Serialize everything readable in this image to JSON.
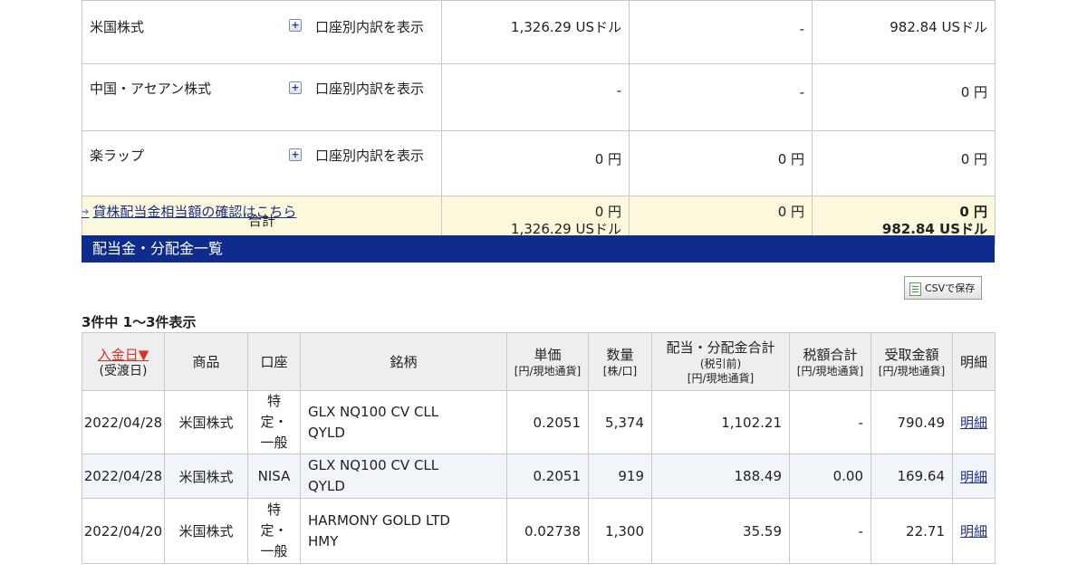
{
  "summary": {
    "rows": [
      {
        "name": "米国株式",
        "detail_link": "口座別内訳を表示",
        "col1": "1,326.29 USドル",
        "col2": "-",
        "col3": "982.84 USドル"
      },
      {
        "name": "中国・アセアン株式",
        "detail_link": "口座別内訳を表示",
        "col1": "-",
        "col2": "-",
        "col3": "0 円"
      },
      {
        "name": "楽ラップ",
        "detail_link": "口座別内訳を表示",
        "col1": "0 円",
        "col2": "0 円",
        "col3": "0 円"
      }
    ],
    "total": {
      "label": "合計",
      "col1_line1": "0 円",
      "col1_line2": "1,326.29 USドル",
      "col2": "0 円",
      "col3_line1": "0 円",
      "col3_line2": "982.84 USドル"
    }
  },
  "lending_link": "貸株配当金相当額の確認はこちら",
  "section_title": "配当金・分配金一覧",
  "csv_button": "CSVで保存",
  "result_count": "3件中 1〜3件表示",
  "table": {
    "headers": {
      "date_main": "入金日▼",
      "date_sub": "(受渡日)",
      "product": "商品",
      "account": "口座",
      "symbol": "銘柄",
      "unit_main": "単価",
      "unit_sub": "[円/現地通貨]",
      "qty_main": "数量",
      "qty_sub": "[株/口]",
      "div_main": "配当・分配金合計",
      "div_sub1": "(税引前)",
      "div_sub2": "[円/現地通貨]",
      "tax_main": "税額合計",
      "tax_sub": "[円/現地通貨]",
      "recv_main": "受取金額",
      "recv_sub": "[円/現地通貨]",
      "detail": "明細"
    },
    "rows": [
      {
        "date": "2022/04/28",
        "product": "米国株式",
        "acct1": "特",
        "acct2": "定・",
        "acct3": "一般",
        "sym1": "GLX NQ100 CV CLL",
        "sym2": "QYLD",
        "unit": "0.2051",
        "qty": "5,374",
        "div": "1,102.21",
        "tax": "-",
        "recv": "790.49",
        "detail": "明細"
      },
      {
        "date": "2022/04/28",
        "product": "米国株式",
        "acct1": "NISA",
        "acct2": "",
        "acct3": "",
        "sym1": "GLX NQ100 CV CLL",
        "sym2": "QYLD",
        "unit": "0.2051",
        "qty": "919",
        "div": "188.49",
        "tax": "0.00",
        "recv": "169.64",
        "detail": "明細"
      },
      {
        "date": "2022/04/20",
        "product": "米国株式",
        "acct1": "特",
        "acct2": "定・",
        "acct3": "一般",
        "sym1": "HARMONY GOLD LTD",
        "sym2": "HMY",
        "unit": "0.02738",
        "qty": "1,300",
        "div": "35.59",
        "tax": "-",
        "recv": "22.71",
        "detail": "明細"
      }
    ]
  }
}
